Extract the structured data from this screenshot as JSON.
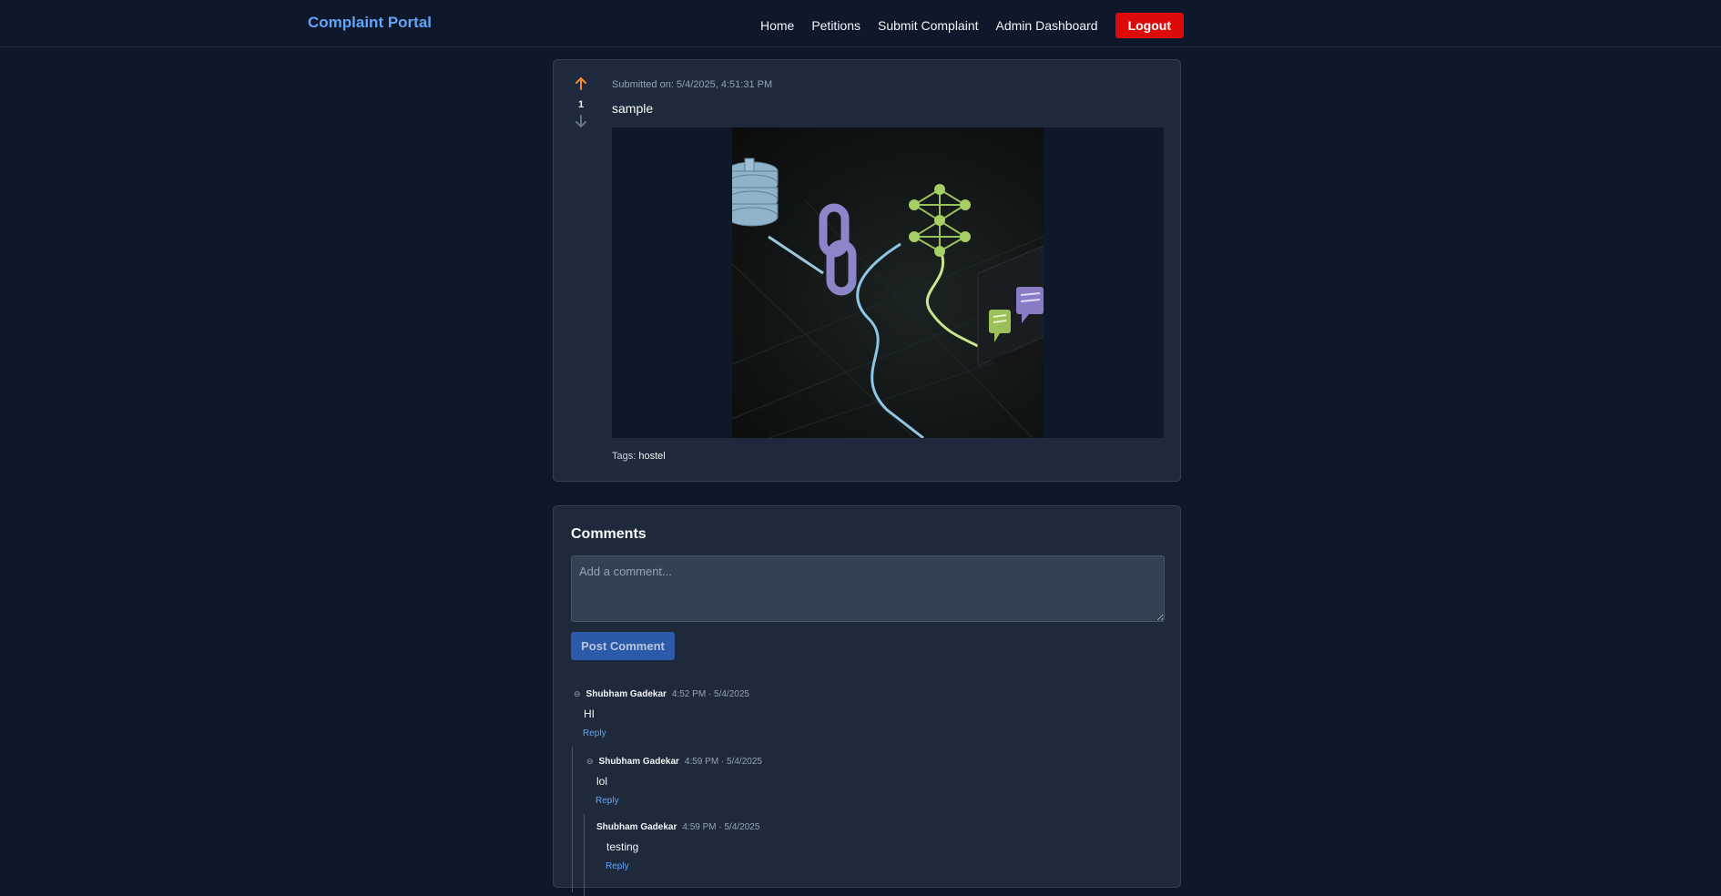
{
  "navbar": {
    "brand": "Complaint Portal",
    "links": [
      "Home",
      "Petitions",
      "Submit Complaint",
      "Admin Dashboard"
    ],
    "logout": "Logout"
  },
  "post": {
    "submitted": "Submitted on: 5/4/2025, 4:51:31 PM",
    "title": "sample",
    "votes": "1",
    "tags_label": "Tags:",
    "tags_value": "hostel"
  },
  "comments": {
    "heading": "Comments",
    "placeholder": "Add a comment...",
    "post_button": "Post Comment",
    "reply_label": "Reply",
    "items": [
      {
        "author": "Shubham Gadekar",
        "time": "4:52 PM · 5/4/2025",
        "text": "HI"
      },
      {
        "author": "Shubham Gadekar",
        "time": "4:59 PM · 5/4/2025",
        "text": "lol"
      },
      {
        "author": "Shubham Gadekar",
        "time": "4:59 PM · 5/4/2025",
        "text": "testing"
      }
    ]
  },
  "colors": {
    "accent": "#60a5fa",
    "logout": "#dc0a0a",
    "upvote": "#f38b2e"
  },
  "icons": [
    "arrow-up-icon",
    "arrow-down-icon",
    "collapse-icon"
  ]
}
